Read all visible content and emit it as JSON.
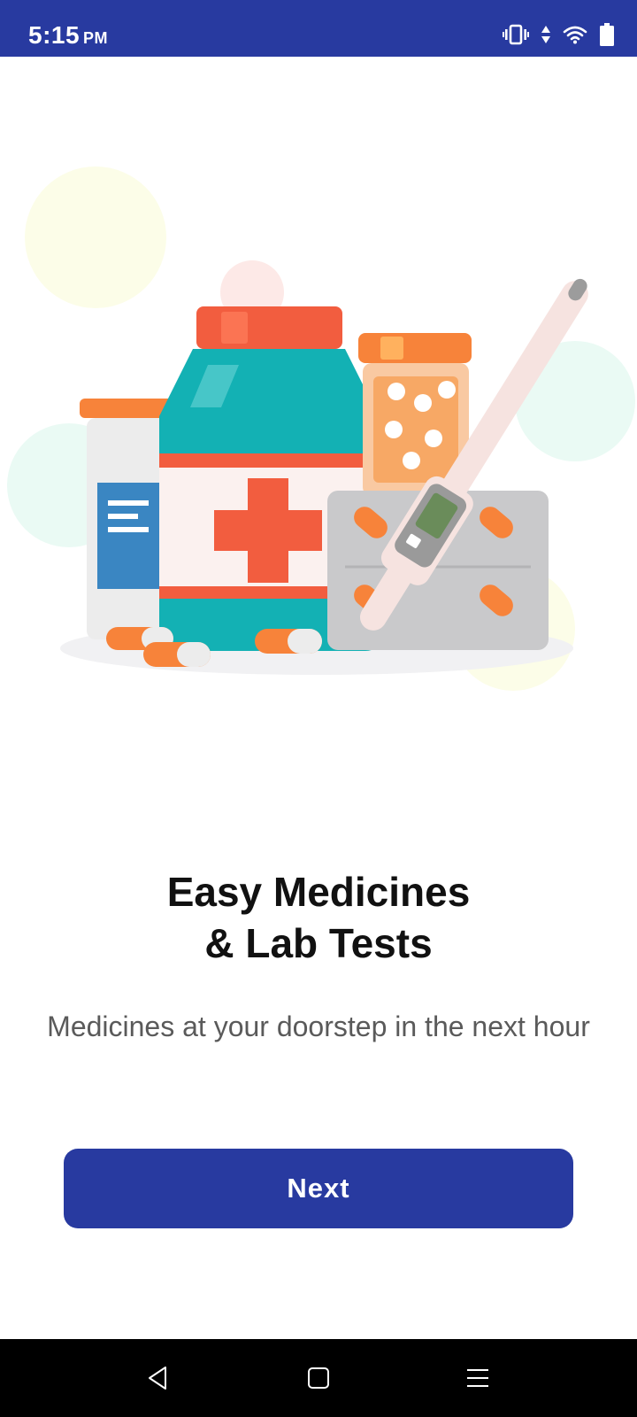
{
  "status_bar": {
    "time": "5:15",
    "ampm": "PM",
    "icons": [
      "vibrate-icon",
      "data-arrows-icon",
      "wifi-icon",
      "battery-icon"
    ],
    "background": "#283aa0"
  },
  "illustration": {
    "subject": "medicine-bottles-pills-thermometer-illustration"
  },
  "onboarding": {
    "title_line1": "Easy Medicines",
    "title_line2": "& Lab Tests",
    "subtitle": "Medicines at your doorstep in the next hour",
    "next_label": "Next"
  },
  "nav_bar": {
    "buttons": [
      "back-icon",
      "home-icon",
      "menu-icon"
    ]
  },
  "colors": {
    "brand": "#283aa0",
    "text_dark": "#111111",
    "text_muted": "#5a5a5a"
  }
}
